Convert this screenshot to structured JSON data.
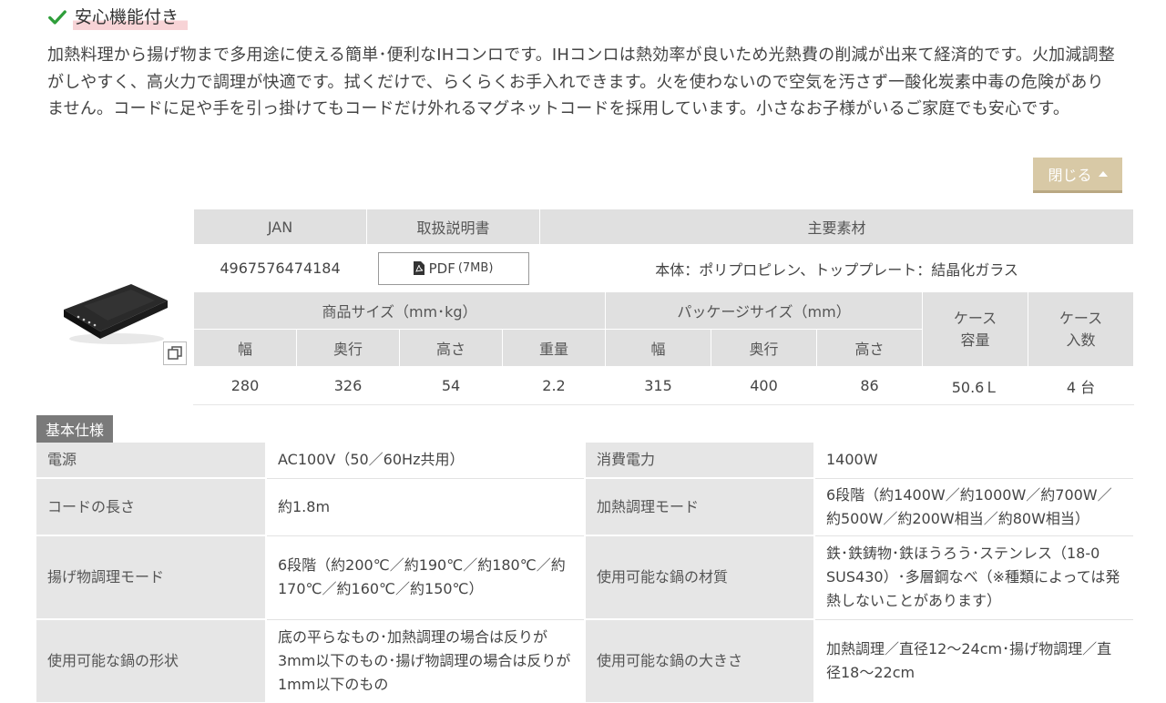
{
  "feature": {
    "title": "安心機能付き",
    "description": "加熱料理から揚げ物まで多用途に使える簡単･便利なIHコンロです。IHコンロは熱効率が良いため光熱費の削減が出来て経済的です。火加減調整がしやすく、高火力で調理が快適です。拭くだけで、らくらくお手入れできます。火を使わないので空気を汚さず一酸化炭素中毒の危険がありません。コードに足や手を引っ掛けてもコードだけ外れるマグネットコードを採用しています。小さなお子様がいるご家庭でも安心です。"
  },
  "close_label": "閉じる",
  "product": {
    "headers": {
      "jan": "JAN",
      "manual": "取扱説明書",
      "material": "主要素材"
    },
    "jan": "4967576474184",
    "pdf_label": "PDF",
    "pdf_size": "(7MB)",
    "material": "本体：ポリプロピレン、トッププレート：結晶化ガラス",
    "size_header": "商品サイズ（mm･kg）",
    "package_header": "パッケージサイズ（mm）",
    "case_capacity_header": [
      "ケース",
      "容量"
    ],
    "case_count_header": [
      "ケース",
      "入数"
    ],
    "size_cols": [
      "幅",
      "奥行",
      "高さ",
      "重量"
    ],
    "package_cols": [
      "幅",
      "奥行",
      "高さ"
    ],
    "size_vals": [
      "280",
      "326",
      "54",
      "2.2"
    ],
    "package_vals": [
      "315",
      "400",
      "86"
    ],
    "case_capacity": "50.6Ｌ",
    "case_count": "4 台"
  },
  "spec": {
    "tag": "基本仕様",
    "rows": [
      {
        "k1": "電源",
        "v1": "AC100V（50／60Hz共用）",
        "k2": "消費電力",
        "v2": "1400W"
      },
      {
        "k1": "コードの長さ",
        "v1": "約1.8m",
        "k2": "加熱調理モード",
        "v2": "6段階（約1400W／約1000W／約700W／約500W／約200W相当／約80W相当）"
      },
      {
        "k1": "揚げ物調理モード",
        "v1": "6段階（約200℃／約190℃／約180℃／約170℃／約160℃／約150℃）",
        "k2": "使用可能な鍋の材質",
        "v2": "鉄･鉄鋳物･鉄ほうろう･ステンレス（18-0 SUS430）･多層鋼なべ（※種類によっては発熱しないことがあります）"
      },
      {
        "k1": "使用可能な鍋の形状",
        "v1": "底の平らなもの･加熱調理の場合は反りが3mm以下のもの･揚げ物調理の場合は反りが1mm以下のもの",
        "k2": "使用可能な鍋の大きさ",
        "v2": "加熱調理／直径12〜24cm･揚げ物調理／直径18〜22cm"
      }
    ]
  },
  "colors": {
    "accent_check": "#2e9e3a",
    "button_bg": "#d8c9a6",
    "header_bg": "#e0e0e0",
    "tag_bg": "#7a7a7a"
  }
}
